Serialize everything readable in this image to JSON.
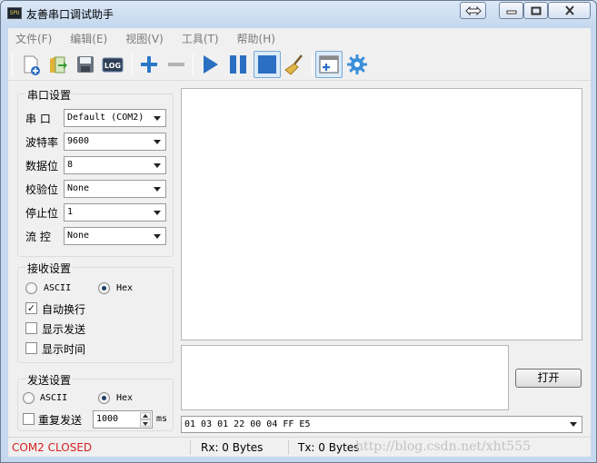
{
  "window": {
    "title": "友善串口调试助手",
    "app_icon_text": "SPU"
  },
  "menu": [
    "文件(F)",
    "编辑(E)",
    "视图(V)",
    "工具(T)",
    "帮助(H)"
  ],
  "toolbar": {
    "icons": [
      "new-icon",
      "open-icon",
      "save-icon",
      "log-icon",
      "add-icon",
      "remove-icon",
      "play-icon",
      "pause-icon",
      "stop-icon",
      "clear-broom-icon",
      "window-add-icon",
      "settings-gear-icon"
    ],
    "log_label": "LOG"
  },
  "serial_settings": {
    "title": "串口设置",
    "port": {
      "label": "串 口",
      "value": "Default (COM2)"
    },
    "baud": {
      "label": "波特率",
      "value": "9600"
    },
    "databits": {
      "label": "数据位",
      "value": "8"
    },
    "parity": {
      "label": "校验位",
      "value": "None"
    },
    "stopbits": {
      "label": "停止位",
      "value": "1"
    },
    "flow": {
      "label": "流 控",
      "value": "None"
    }
  },
  "receive_settings": {
    "title": "接收设置",
    "ascii": "ASCII",
    "hex": "Hex",
    "hex_selected": true,
    "auto_newline": "自动换行",
    "auto_newline_checked": true,
    "show_send": "显示发送",
    "show_time": "显示时间"
  },
  "send_settings": {
    "title": "发送设置",
    "ascii": "ASCII",
    "hex": "Hex",
    "hex_selected": true,
    "repeat": "重复发送",
    "interval": "1000",
    "unit": "ms"
  },
  "open_button": "打开",
  "send_history": "01 03 01 22 00 04 FF E5",
  "status": {
    "port": "COM2 CLOSED",
    "port_color": "#d42020",
    "rx": "Rx: 0 Bytes",
    "tx": "Tx: 0 Bytes"
  },
  "watermark": "http://blog.csdn.net/xht555"
}
